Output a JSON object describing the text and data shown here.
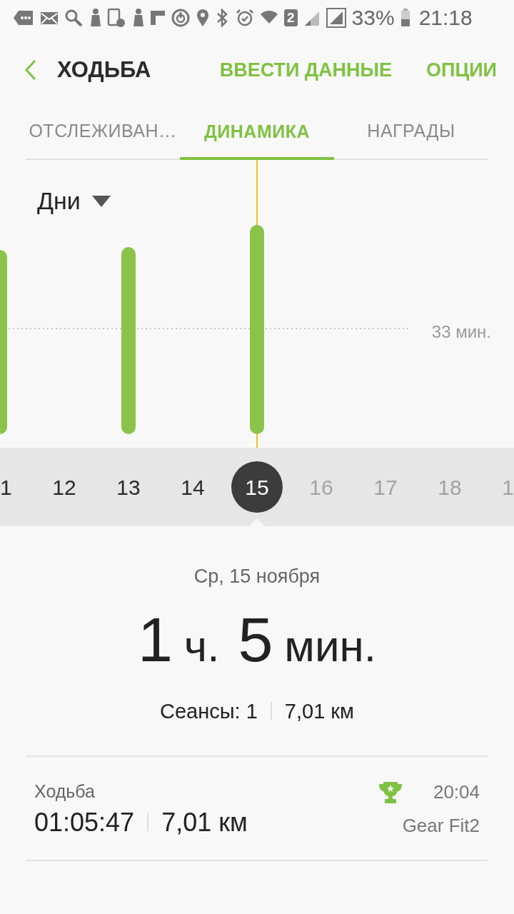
{
  "status_bar": {
    "sim_badge": "2",
    "battery": "33%",
    "time": "21:18"
  },
  "header": {
    "title": "ХОДЬБА",
    "actions": [
      "ВВЕСТИ ДАННЫЕ",
      "ОПЦИИ"
    ]
  },
  "tabs": [
    {
      "label": "ОТСЛЕЖИВАН…",
      "selected": false
    },
    {
      "label": "ДИНАМИКА",
      "selected": true
    },
    {
      "label": "НАГРАДЫ",
      "selected": false
    }
  ],
  "chart": {
    "period": "Дни",
    "reference_label": "33 мин."
  },
  "days": [
    {
      "label": "1",
      "selected": false,
      "disabled": false
    },
    {
      "label": "12",
      "selected": false,
      "disabled": false
    },
    {
      "label": "13",
      "selected": false,
      "disabled": false
    },
    {
      "label": "14",
      "selected": false,
      "disabled": false
    },
    {
      "label": "15",
      "selected": true,
      "disabled": false
    },
    {
      "label": "16",
      "selected": false,
      "disabled": true
    },
    {
      "label": "17",
      "selected": false,
      "disabled": true
    },
    {
      "label": "18",
      "selected": false,
      "disabled": true
    },
    {
      "label": "1",
      "selected": false,
      "disabled": true
    }
  ],
  "summary": {
    "date": "Ср, 15 ноября",
    "duration": [
      {
        "value": "1",
        "unit": "ч."
      },
      {
        "value": "5",
        "unit": "мин."
      }
    ],
    "sessions": "Сеансы: 1",
    "distance": "7,01 км"
  },
  "records": [
    {
      "title": "Ходьба",
      "duration": "01:05:47",
      "distance": "7,01 км",
      "award": true,
      "time": "20:04",
      "device": "Gear Fit2"
    }
  ]
}
